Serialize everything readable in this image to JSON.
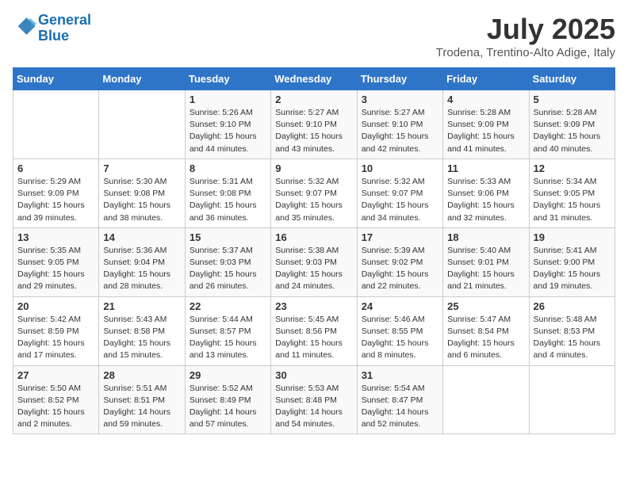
{
  "logo": {
    "line1": "General",
    "line2": "Blue"
  },
  "title": "July 2025",
  "location": "Trodena, Trentino-Alto Adige, Italy",
  "days_header": [
    "Sunday",
    "Monday",
    "Tuesday",
    "Wednesday",
    "Thursday",
    "Friday",
    "Saturday"
  ],
  "weeks": [
    [
      {
        "num": "",
        "info": ""
      },
      {
        "num": "",
        "info": ""
      },
      {
        "num": "1",
        "info": "Sunrise: 5:26 AM\nSunset: 9:10 PM\nDaylight: 15 hours\nand 44 minutes."
      },
      {
        "num": "2",
        "info": "Sunrise: 5:27 AM\nSunset: 9:10 PM\nDaylight: 15 hours\nand 43 minutes."
      },
      {
        "num": "3",
        "info": "Sunrise: 5:27 AM\nSunset: 9:10 PM\nDaylight: 15 hours\nand 42 minutes."
      },
      {
        "num": "4",
        "info": "Sunrise: 5:28 AM\nSunset: 9:09 PM\nDaylight: 15 hours\nand 41 minutes."
      },
      {
        "num": "5",
        "info": "Sunrise: 5:28 AM\nSunset: 9:09 PM\nDaylight: 15 hours\nand 40 minutes."
      }
    ],
    [
      {
        "num": "6",
        "info": "Sunrise: 5:29 AM\nSunset: 9:09 PM\nDaylight: 15 hours\nand 39 minutes."
      },
      {
        "num": "7",
        "info": "Sunrise: 5:30 AM\nSunset: 9:08 PM\nDaylight: 15 hours\nand 38 minutes."
      },
      {
        "num": "8",
        "info": "Sunrise: 5:31 AM\nSunset: 9:08 PM\nDaylight: 15 hours\nand 36 minutes."
      },
      {
        "num": "9",
        "info": "Sunrise: 5:32 AM\nSunset: 9:07 PM\nDaylight: 15 hours\nand 35 minutes."
      },
      {
        "num": "10",
        "info": "Sunrise: 5:32 AM\nSunset: 9:07 PM\nDaylight: 15 hours\nand 34 minutes."
      },
      {
        "num": "11",
        "info": "Sunrise: 5:33 AM\nSunset: 9:06 PM\nDaylight: 15 hours\nand 32 minutes."
      },
      {
        "num": "12",
        "info": "Sunrise: 5:34 AM\nSunset: 9:05 PM\nDaylight: 15 hours\nand 31 minutes."
      }
    ],
    [
      {
        "num": "13",
        "info": "Sunrise: 5:35 AM\nSunset: 9:05 PM\nDaylight: 15 hours\nand 29 minutes."
      },
      {
        "num": "14",
        "info": "Sunrise: 5:36 AM\nSunset: 9:04 PM\nDaylight: 15 hours\nand 28 minutes."
      },
      {
        "num": "15",
        "info": "Sunrise: 5:37 AM\nSunset: 9:03 PM\nDaylight: 15 hours\nand 26 minutes."
      },
      {
        "num": "16",
        "info": "Sunrise: 5:38 AM\nSunset: 9:03 PM\nDaylight: 15 hours\nand 24 minutes."
      },
      {
        "num": "17",
        "info": "Sunrise: 5:39 AM\nSunset: 9:02 PM\nDaylight: 15 hours\nand 22 minutes."
      },
      {
        "num": "18",
        "info": "Sunrise: 5:40 AM\nSunset: 9:01 PM\nDaylight: 15 hours\nand 21 minutes."
      },
      {
        "num": "19",
        "info": "Sunrise: 5:41 AM\nSunset: 9:00 PM\nDaylight: 15 hours\nand 19 minutes."
      }
    ],
    [
      {
        "num": "20",
        "info": "Sunrise: 5:42 AM\nSunset: 8:59 PM\nDaylight: 15 hours\nand 17 minutes."
      },
      {
        "num": "21",
        "info": "Sunrise: 5:43 AM\nSunset: 8:58 PM\nDaylight: 15 hours\nand 15 minutes."
      },
      {
        "num": "22",
        "info": "Sunrise: 5:44 AM\nSunset: 8:57 PM\nDaylight: 15 hours\nand 13 minutes."
      },
      {
        "num": "23",
        "info": "Sunrise: 5:45 AM\nSunset: 8:56 PM\nDaylight: 15 hours\nand 11 minutes."
      },
      {
        "num": "24",
        "info": "Sunrise: 5:46 AM\nSunset: 8:55 PM\nDaylight: 15 hours\nand 8 minutes."
      },
      {
        "num": "25",
        "info": "Sunrise: 5:47 AM\nSunset: 8:54 PM\nDaylight: 15 hours\nand 6 minutes."
      },
      {
        "num": "26",
        "info": "Sunrise: 5:48 AM\nSunset: 8:53 PM\nDaylight: 15 hours\nand 4 minutes."
      }
    ],
    [
      {
        "num": "27",
        "info": "Sunrise: 5:50 AM\nSunset: 8:52 PM\nDaylight: 15 hours\nand 2 minutes."
      },
      {
        "num": "28",
        "info": "Sunrise: 5:51 AM\nSunset: 8:51 PM\nDaylight: 14 hours\nand 59 minutes."
      },
      {
        "num": "29",
        "info": "Sunrise: 5:52 AM\nSunset: 8:49 PM\nDaylight: 14 hours\nand 57 minutes."
      },
      {
        "num": "30",
        "info": "Sunrise: 5:53 AM\nSunset: 8:48 PM\nDaylight: 14 hours\nand 54 minutes."
      },
      {
        "num": "31",
        "info": "Sunrise: 5:54 AM\nSunset: 8:47 PM\nDaylight: 14 hours\nand 52 minutes."
      },
      {
        "num": "",
        "info": ""
      },
      {
        "num": "",
        "info": ""
      }
    ]
  ]
}
